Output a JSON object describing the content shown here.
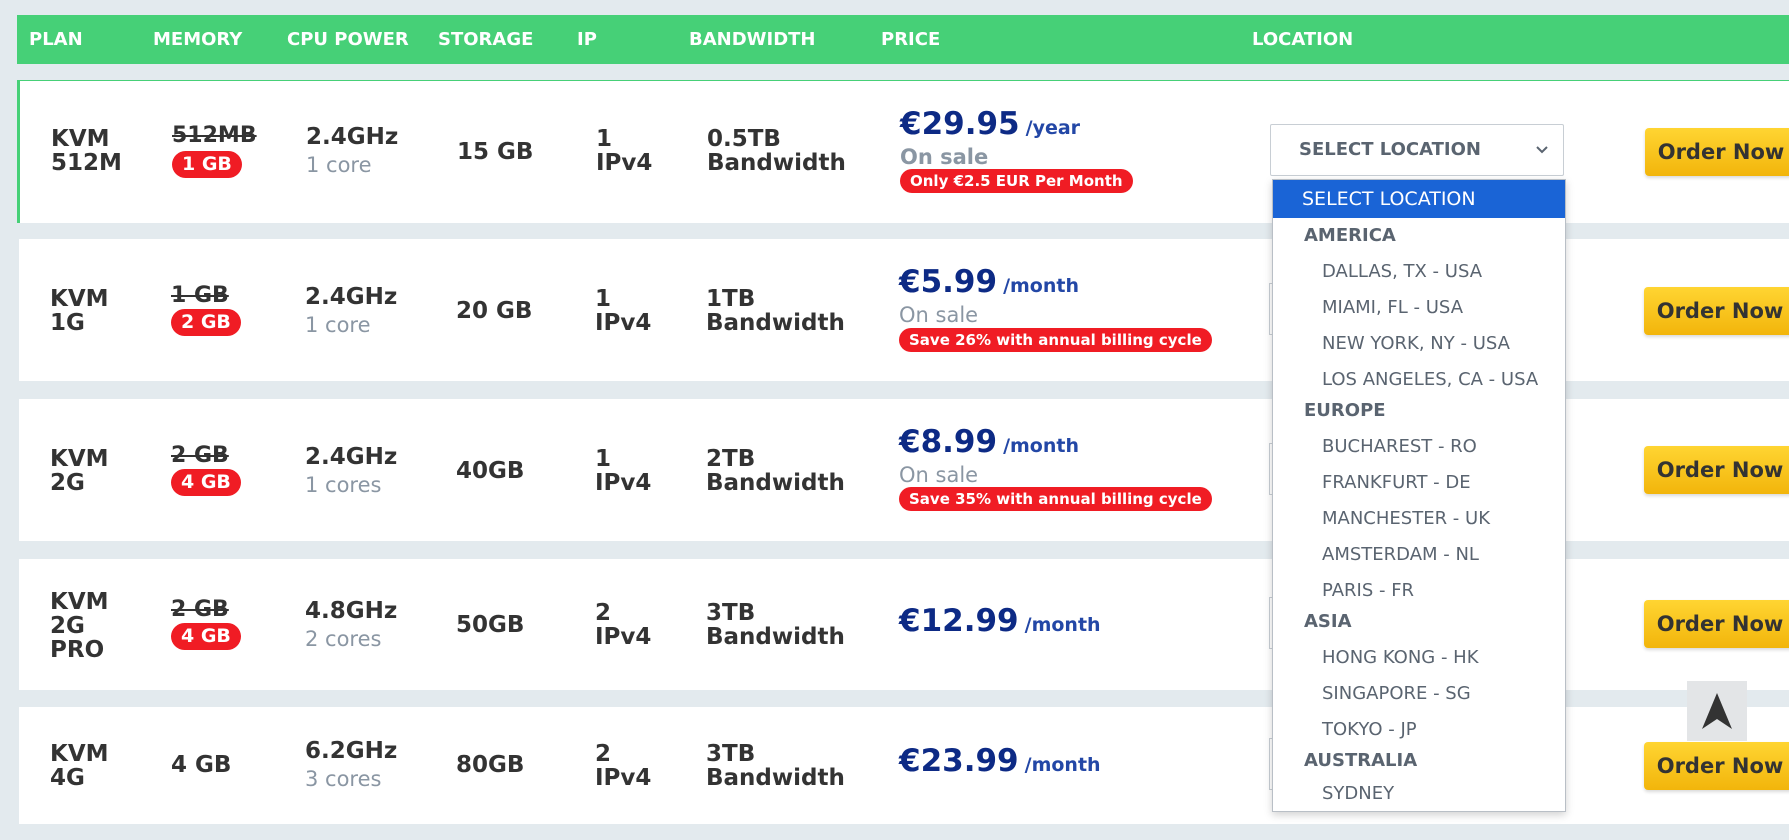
{
  "columns": [
    "PLAN",
    "MEMORY",
    "CPU POWER",
    "STORAGE",
    "IP",
    "BANDWIDTH",
    "PRICE",
    "LOCATION"
  ],
  "plans": [
    {
      "name_lines": [
        "KVM",
        "512M"
      ],
      "mem_old": "512MB",
      "mem_new": "1 GB",
      "cpu": "2.4GHz",
      "cores": "1 core",
      "storage": "15 GB",
      "ip": [
        "1",
        "IPv4"
      ],
      "bw": [
        "0.5TB",
        "Bandwidth"
      ],
      "price": "€29.95",
      "period": "/year",
      "sale": "On sale",
      "promo": "Only €2.5 EUR Per Month"
    },
    {
      "name_lines": [
        "KVM",
        "1G"
      ],
      "mem_old": "1 GB",
      "mem_new": "2 GB",
      "cpu": "2.4GHz",
      "cores": "1 core",
      "storage": "20 GB",
      "ip": [
        "1",
        "IPv4"
      ],
      "bw": [
        "1TB",
        "Bandwidth"
      ],
      "price": "€5.99",
      "period": "/month",
      "sale": "On sale",
      "promo": "Save 26% with annual billing cycle"
    },
    {
      "name_lines": [
        "KVM",
        "2G"
      ],
      "mem_old": "2 GB",
      "mem_new": "4 GB",
      "cpu": "2.4GHz",
      "cores": "1 cores",
      "storage": "40GB",
      "ip": [
        "1",
        "IPv4"
      ],
      "bw": [
        "2TB",
        "Bandwidth"
      ],
      "price": "€8.99",
      "period": "/month",
      "sale": "On sale",
      "promo": "Save 35% with annual billing cycle"
    },
    {
      "name_lines": [
        "KVM",
        "2G",
        "PRO"
      ],
      "mem_old": "2 GB",
      "mem_new": "4 GB",
      "cpu": "4.8GHz",
      "cores": "2 cores",
      "storage": "50GB",
      "ip": [
        "2",
        "IPv4"
      ],
      "bw": [
        "3TB",
        "Bandwidth"
      ],
      "price": "€12.99",
      "period": "/month"
    },
    {
      "name_lines": [
        "KVM",
        "4G"
      ],
      "mem_plain": "4 GB",
      "cpu": "6.2GHz",
      "cores": "3 cores",
      "storage": "80GB",
      "ip": [
        "2",
        "IPv4"
      ],
      "bw": [
        "3TB",
        "Bandwidth"
      ],
      "price": "€23.99",
      "period": "/month"
    }
  ],
  "location_select": {
    "value": "SELECT LOCATION",
    "groups": [
      {
        "label": "AMERICA",
        "options": [
          "DALLAS, TX - USA",
          "MIAMI, FL - USA",
          "NEW YORK, NY - USA",
          "LOS ANGELES, CA - USA"
        ]
      },
      {
        "label": "EUROPE",
        "options": [
          "BUCHAREST - RO",
          "FRANKFURT - DE",
          "MANCHESTER - UK",
          "AMSTERDAM - NL",
          "PARIS - FR"
        ]
      },
      {
        "label": "ASIA",
        "options": [
          "HONG KONG - HK",
          "SINGAPORE - SG",
          "TOKYO - JP"
        ]
      },
      {
        "label": "AUSTRALIA",
        "options": [
          "SYDNEY"
        ]
      }
    ]
  },
  "order_label": "Order Now",
  "icons": {
    "select": "chevron-down-icon",
    "scroll": "arrow-up-icon"
  },
  "colors": {
    "header": "#46d077",
    "badge": "#f01c24",
    "price": "#0d2a85",
    "order": "#f7c21c",
    "dropdown_selected": "#1a64d6"
  }
}
